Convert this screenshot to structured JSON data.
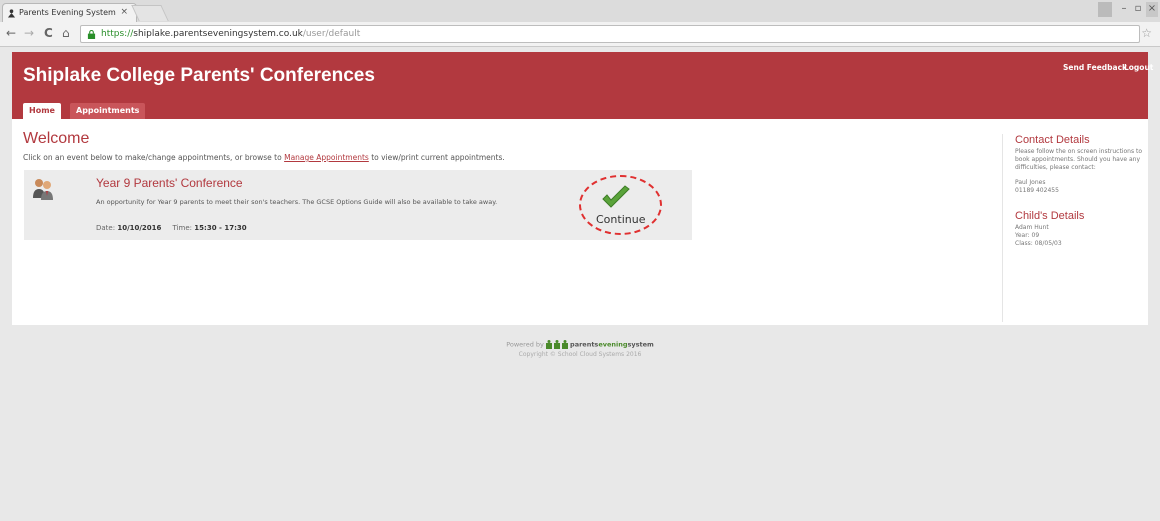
{
  "browser": {
    "tab_title": "Parents Evening System",
    "tab_close": "×",
    "url_scheme": "https://",
    "url_host": "shiplake.parentseveningsystem.co.uk",
    "url_path": "/user/default",
    "back_icon": "←",
    "forward_icon": "→",
    "reload_icon": "C",
    "home_icon": "⌂",
    "star_icon": "☆"
  },
  "header": {
    "title": "Shiplake College Parents' Conferences",
    "send_feedback": "Send Feedback",
    "logout": "Logout",
    "tabs": [
      {
        "label": "Home"
      },
      {
        "label": "Appointments"
      }
    ]
  },
  "main": {
    "heading": "Welcome",
    "intro_before": "Click on an event below to make/change appointments, or browse to ",
    "intro_link": "Manage Appointments",
    "intro_after": " to view/print current appointments.",
    "event": {
      "title": "Year 9 Parents' Conference",
      "description": "An opportunity for Year 9 parents to meet their son's teachers. The GCSE Options Guide will also be available to take away.",
      "date_label": "Date:",
      "date": "10/10/2016",
      "time_label": "Time:",
      "time": "15:30 - 17:30",
      "continue_label": "Continue"
    }
  },
  "sidebar": {
    "contact_heading": "Contact Details",
    "contact_text": "Please follow the on screen instructions to book appointments. Should you have any difficulties, please contact:",
    "contact_name": "Paul Jones",
    "contact_phone": "01189 402455",
    "child_heading": "Child's Details",
    "child_name": "Adam Hunt",
    "child_year": "Year: 09",
    "child_class": "Class: 08/05/03"
  },
  "footer": {
    "powered_by": "Powered by",
    "brand_a": "parents",
    "brand_b": "evening",
    "brand_c": "system",
    "copyright": "Copyright © School Cloud Systems 2016"
  },
  "colors": {
    "brand_red": "#b2393f",
    "check_green": "#5aa33a"
  }
}
